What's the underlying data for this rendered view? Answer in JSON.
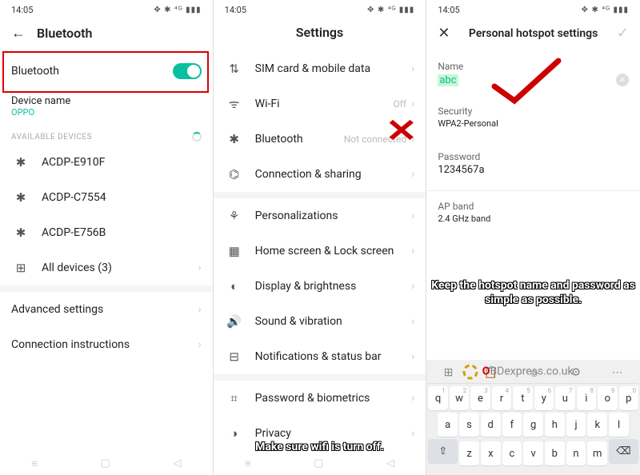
{
  "screen1": {
    "time": "14:05",
    "statusIcons": "✥ ✱ ⁴ᴳ ▮▮▮",
    "title": "Bluetooth",
    "toggleLabel": "Bluetooth",
    "deviceNameLabel": "Device name",
    "deviceName": "OPPO",
    "availableLabel": "AVAILABLE DEVICES",
    "devices": [
      "ACDP-E910F",
      "ACDP-C7554",
      "ACDP-E756B"
    ],
    "allDevices": "All devices (3)",
    "advanced": "Advanced settings",
    "instructions": "Connection instructions"
  },
  "screen2": {
    "time": "14:05",
    "statusIcons": "✥ ✱ ⁴ᴳ ▮▮▮",
    "title": "Settings",
    "items": [
      {
        "icon": "⇅",
        "label": "SIM card & mobile data",
        "right": ""
      },
      {
        "icon": "ᯤ",
        "label": "Wi-Fi",
        "right": "Off"
      },
      {
        "icon": "✱",
        "label": "Bluetooth",
        "right": "Not connected"
      },
      {
        "icon": "⌬",
        "label": "Connection & sharing",
        "right": ""
      }
    ],
    "items2": [
      {
        "icon": "⚘",
        "label": "Personalizations"
      },
      {
        "icon": "▦",
        "label": "Home screen & Lock screen"
      },
      {
        "icon": "◐",
        "label": "Display & brightness"
      },
      {
        "icon": "🔊",
        "label": "Sound & vibration"
      },
      {
        "icon": "⊟",
        "label": "Notifications & status bar"
      }
    ],
    "items3": [
      {
        "icon": "⌗",
        "label": "Password & biometrics"
      },
      {
        "icon": "◑",
        "label": "Privacy"
      }
    ],
    "caption": "Make sure wifi is turn off."
  },
  "screen3": {
    "time": "14:05",
    "statusIcons": "✥ ✱ ⁴ᴳ ▮▮▮",
    "title": "Personal hotspot settings",
    "nameLabel": "Name",
    "nameValue": "abc",
    "securityLabel": "Security",
    "securityValue": "WPA2-Personal",
    "passwordLabel": "Password",
    "passwordValue": "1234567a",
    "apLabel": "AP band",
    "apValue": "2.4 GHz band",
    "caption": "Keep the hotspot name and password as simple as possible.",
    "kb": {
      "row1": [
        "q",
        "w",
        "e",
        "r",
        "t",
        "y",
        "u",
        "i",
        "o",
        "p"
      ],
      "hints1": [
        "1",
        "2",
        "3",
        "4",
        "5",
        "6",
        "7",
        "8",
        "9",
        "0"
      ],
      "row2": [
        "a",
        "s",
        "d",
        "f",
        "g",
        "h",
        "j",
        "k",
        "l"
      ],
      "row3": [
        "z",
        "x",
        "c",
        "v",
        "b",
        "n",
        "m"
      ]
    }
  },
  "watermark": "BDexpress.co.uk"
}
